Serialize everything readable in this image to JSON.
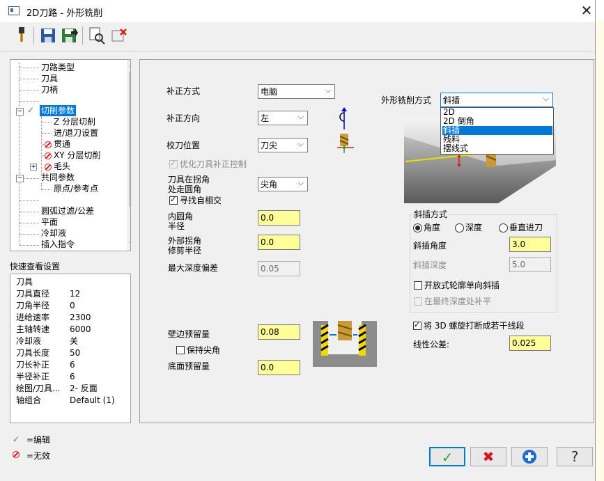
{
  "window": {
    "title": "2D刀路 - 外形铣削"
  },
  "tree": {
    "items": [
      {
        "label": "刀路类型",
        "status": "none"
      },
      {
        "label": "刀具",
        "status": "none"
      },
      {
        "label": "刀柄",
        "status": "none"
      },
      {
        "label": "",
        "status": "none"
      },
      {
        "label": "切削参数",
        "status": "edited",
        "selected": true
      },
      {
        "label": "Z 分层切削",
        "status": "none"
      },
      {
        "label": "进/退刀设置",
        "status": "none"
      },
      {
        "label": "贯通",
        "status": "disabled"
      },
      {
        "label": "XY 分层切削",
        "status": "disabled"
      },
      {
        "label": "毛头",
        "status": "disabled"
      },
      {
        "label": "共同参数",
        "status": "none"
      },
      {
        "label": "原点/参考点",
        "status": "none"
      },
      {
        "label": "",
        "status": "none"
      },
      {
        "label": "圆弧过滤/公差",
        "status": "none"
      },
      {
        "label": "平面",
        "status": "none"
      },
      {
        "label": "冷却液",
        "status": "none"
      },
      {
        "label": "插入指令",
        "status": "none"
      }
    ]
  },
  "quickview": {
    "title": "快速查看设置",
    "rows": [
      {
        "k": "刀具",
        "v": ""
      },
      {
        "k": "刀具直径",
        "v": "12"
      },
      {
        "k": "刀角半径",
        "v": "0"
      },
      {
        "k": "进给速率",
        "v": "2300"
      },
      {
        "k": "主轴转速",
        "v": "6000"
      },
      {
        "k": "冷却液",
        "v": "关"
      },
      {
        "k": "刀具长度",
        "v": "50"
      },
      {
        "k": "刀长补正",
        "v": "6"
      },
      {
        "k": "半径补正",
        "v": "6"
      },
      {
        "k": "绘图/刀具...",
        "v": "2- 反面"
      },
      {
        "k": "轴组合",
        "v": "Default (1)"
      }
    ]
  },
  "legend": {
    "edited": "=编辑",
    "disabled": "=无效"
  },
  "params": {
    "comp_type_label": "补正方式",
    "comp_type_value": "电脑",
    "comp_dir_label": "补正方向",
    "comp_dir_value": "左",
    "tip_comp_label": "校刀位置",
    "tip_comp_value": "刀尖",
    "optimize_label": "优化刀具补正控制",
    "roll_corner_label1": "刀具在拐角",
    "roll_corner_label2": "处走圆角",
    "roll_corner_value": "尖角",
    "find_intersect_label": "寻找自相交",
    "inner_radius_label1": "内圆角",
    "inner_radius_label2": "半径",
    "inner_radius_value": "0.0",
    "outer_radius_label1": "外部拐角",
    "outer_radius_label2": "修剪半径",
    "outer_radius_value": "0.0",
    "max_depth_label": "最大深度偏差",
    "max_depth_value": "0.05",
    "wall_stock_label": "壁边预留量",
    "wall_stock_value": "0.08",
    "keep_sharp_label": "保持尖角",
    "floor_stock_label": "底面预留量",
    "floor_stock_value": "0.0"
  },
  "contour": {
    "type_label": "外形铣削方式",
    "type_value": "斜插",
    "options": [
      "2D",
      "2D 倒角",
      "斜插",
      "残料",
      "摆线式"
    ],
    "selected_index": 2
  },
  "ramp": {
    "group_label": "斜插方式",
    "radio_angle": "角度",
    "radio_depth": "深度",
    "radio_plunge": "垂直进刀",
    "angle_label": "斜插角度",
    "angle_value": "3.0",
    "depth_label": "斜插深度",
    "depth_value": "5.0",
    "open_contour_label": "开放式轮廓单向斜插",
    "final_depth_label": "在最终深度处补平"
  },
  "helix": {
    "break_label": "将 3D 螺旋打断成若干线段",
    "tol_label": "线性公差:",
    "tol_value": "0.025"
  },
  "buttons": {
    "ok": "✓",
    "cancel": "✖",
    "help": "?"
  },
  "colors": {
    "selection": "#0078d7",
    "input_yellow": "#ffff99",
    "edited_green": "#2aa62a",
    "disabled_red": "#d9161b"
  }
}
